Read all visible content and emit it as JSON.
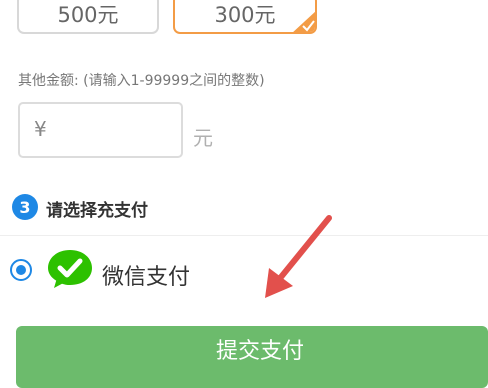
{
  "amounts": [
    {
      "label": "500元",
      "selected": false
    },
    {
      "label": "300元",
      "selected": true
    }
  ],
  "other_amount": {
    "label": "其他金额: (请输入1-99999之间的整数)",
    "currency_symbol": "¥",
    "value": "",
    "unit": "元"
  },
  "payment_section": {
    "step_number": "3",
    "title": "请选择充支付"
  },
  "payment_methods": [
    {
      "label": "微信支付",
      "selected": true,
      "icon": "wechat-icon"
    }
  ],
  "submit": {
    "label": "提交支付"
  },
  "colors": {
    "accent_blue": "#1e88e5",
    "selected_orange": "#f39c46",
    "submit_green": "#6cbb6c",
    "arrow_red": "#e2504c",
    "wechat_green": "#2dc100"
  }
}
